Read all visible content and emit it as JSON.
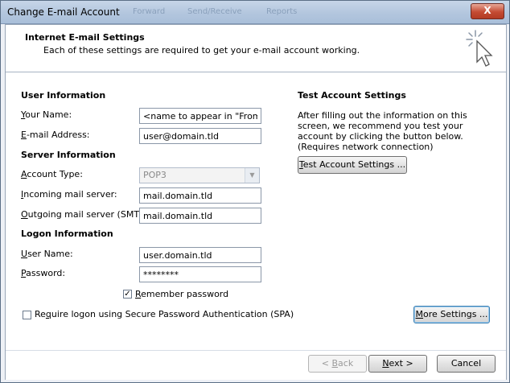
{
  "window": {
    "title": "Change E-mail Account",
    "close_label": "X",
    "background_tabs": [
      "Forward",
      "Send/Receive",
      "Reports"
    ]
  },
  "header": {
    "title": "Internet E-mail Settings",
    "subtitle": "Each of these settings are required to get your e-mail account working.",
    "icon": "wizard-cursor-icon"
  },
  "user_info": {
    "heading": "User Information",
    "your_name_label_u": "Y",
    "your_name_label_rest": "our Name:",
    "your_name_value": "<name to appear in \"From\">",
    "email_label_u": "E",
    "email_label_rest": "-mail Address:",
    "email_value": "user@domain.tld"
  },
  "server_info": {
    "heading": "Server Information",
    "account_type_label_u": "A",
    "account_type_label_rest": "ccount Type:",
    "account_type_value": "POP3",
    "incoming_label_u": "I",
    "incoming_label_rest": "ncoming mail server:",
    "incoming_value": "mail.domain.tld",
    "outgoing_label_u": "O",
    "outgoing_label_rest": "utgoing mail server (SMTP):",
    "outgoing_value": "mail.domain.tld"
  },
  "logon_info": {
    "heading": "Logon Information",
    "username_label_u": "U",
    "username_label_rest": "ser Name:",
    "username_value": "user.domain.tld",
    "password_label_u": "P",
    "password_label_rest": "assword:",
    "password_value": "********",
    "remember_label_u": "R",
    "remember_label_rest": "emember password",
    "remember_checked": true,
    "spa_label_u": "q",
    "spa_label_pre": "Re",
    "spa_label_rest": "uire logon using Secure Password Authentication (SPA)",
    "spa_checked": false
  },
  "test_settings": {
    "heading": "Test Account Settings",
    "description": "After filling out the information on this screen, we recommend you test your account by clicking the button below. (Requires network connection)",
    "button_u": "T",
    "button_rest": "est Account Settings ..."
  },
  "more_settings": {
    "button_u": "M",
    "button_rest": "ore Settings ..."
  },
  "footer": {
    "back_pre": "< ",
    "back_u": "B",
    "back_rest": "ack",
    "next_u": "N",
    "next_rest": "ext >",
    "cancel_label": "Cancel"
  }
}
